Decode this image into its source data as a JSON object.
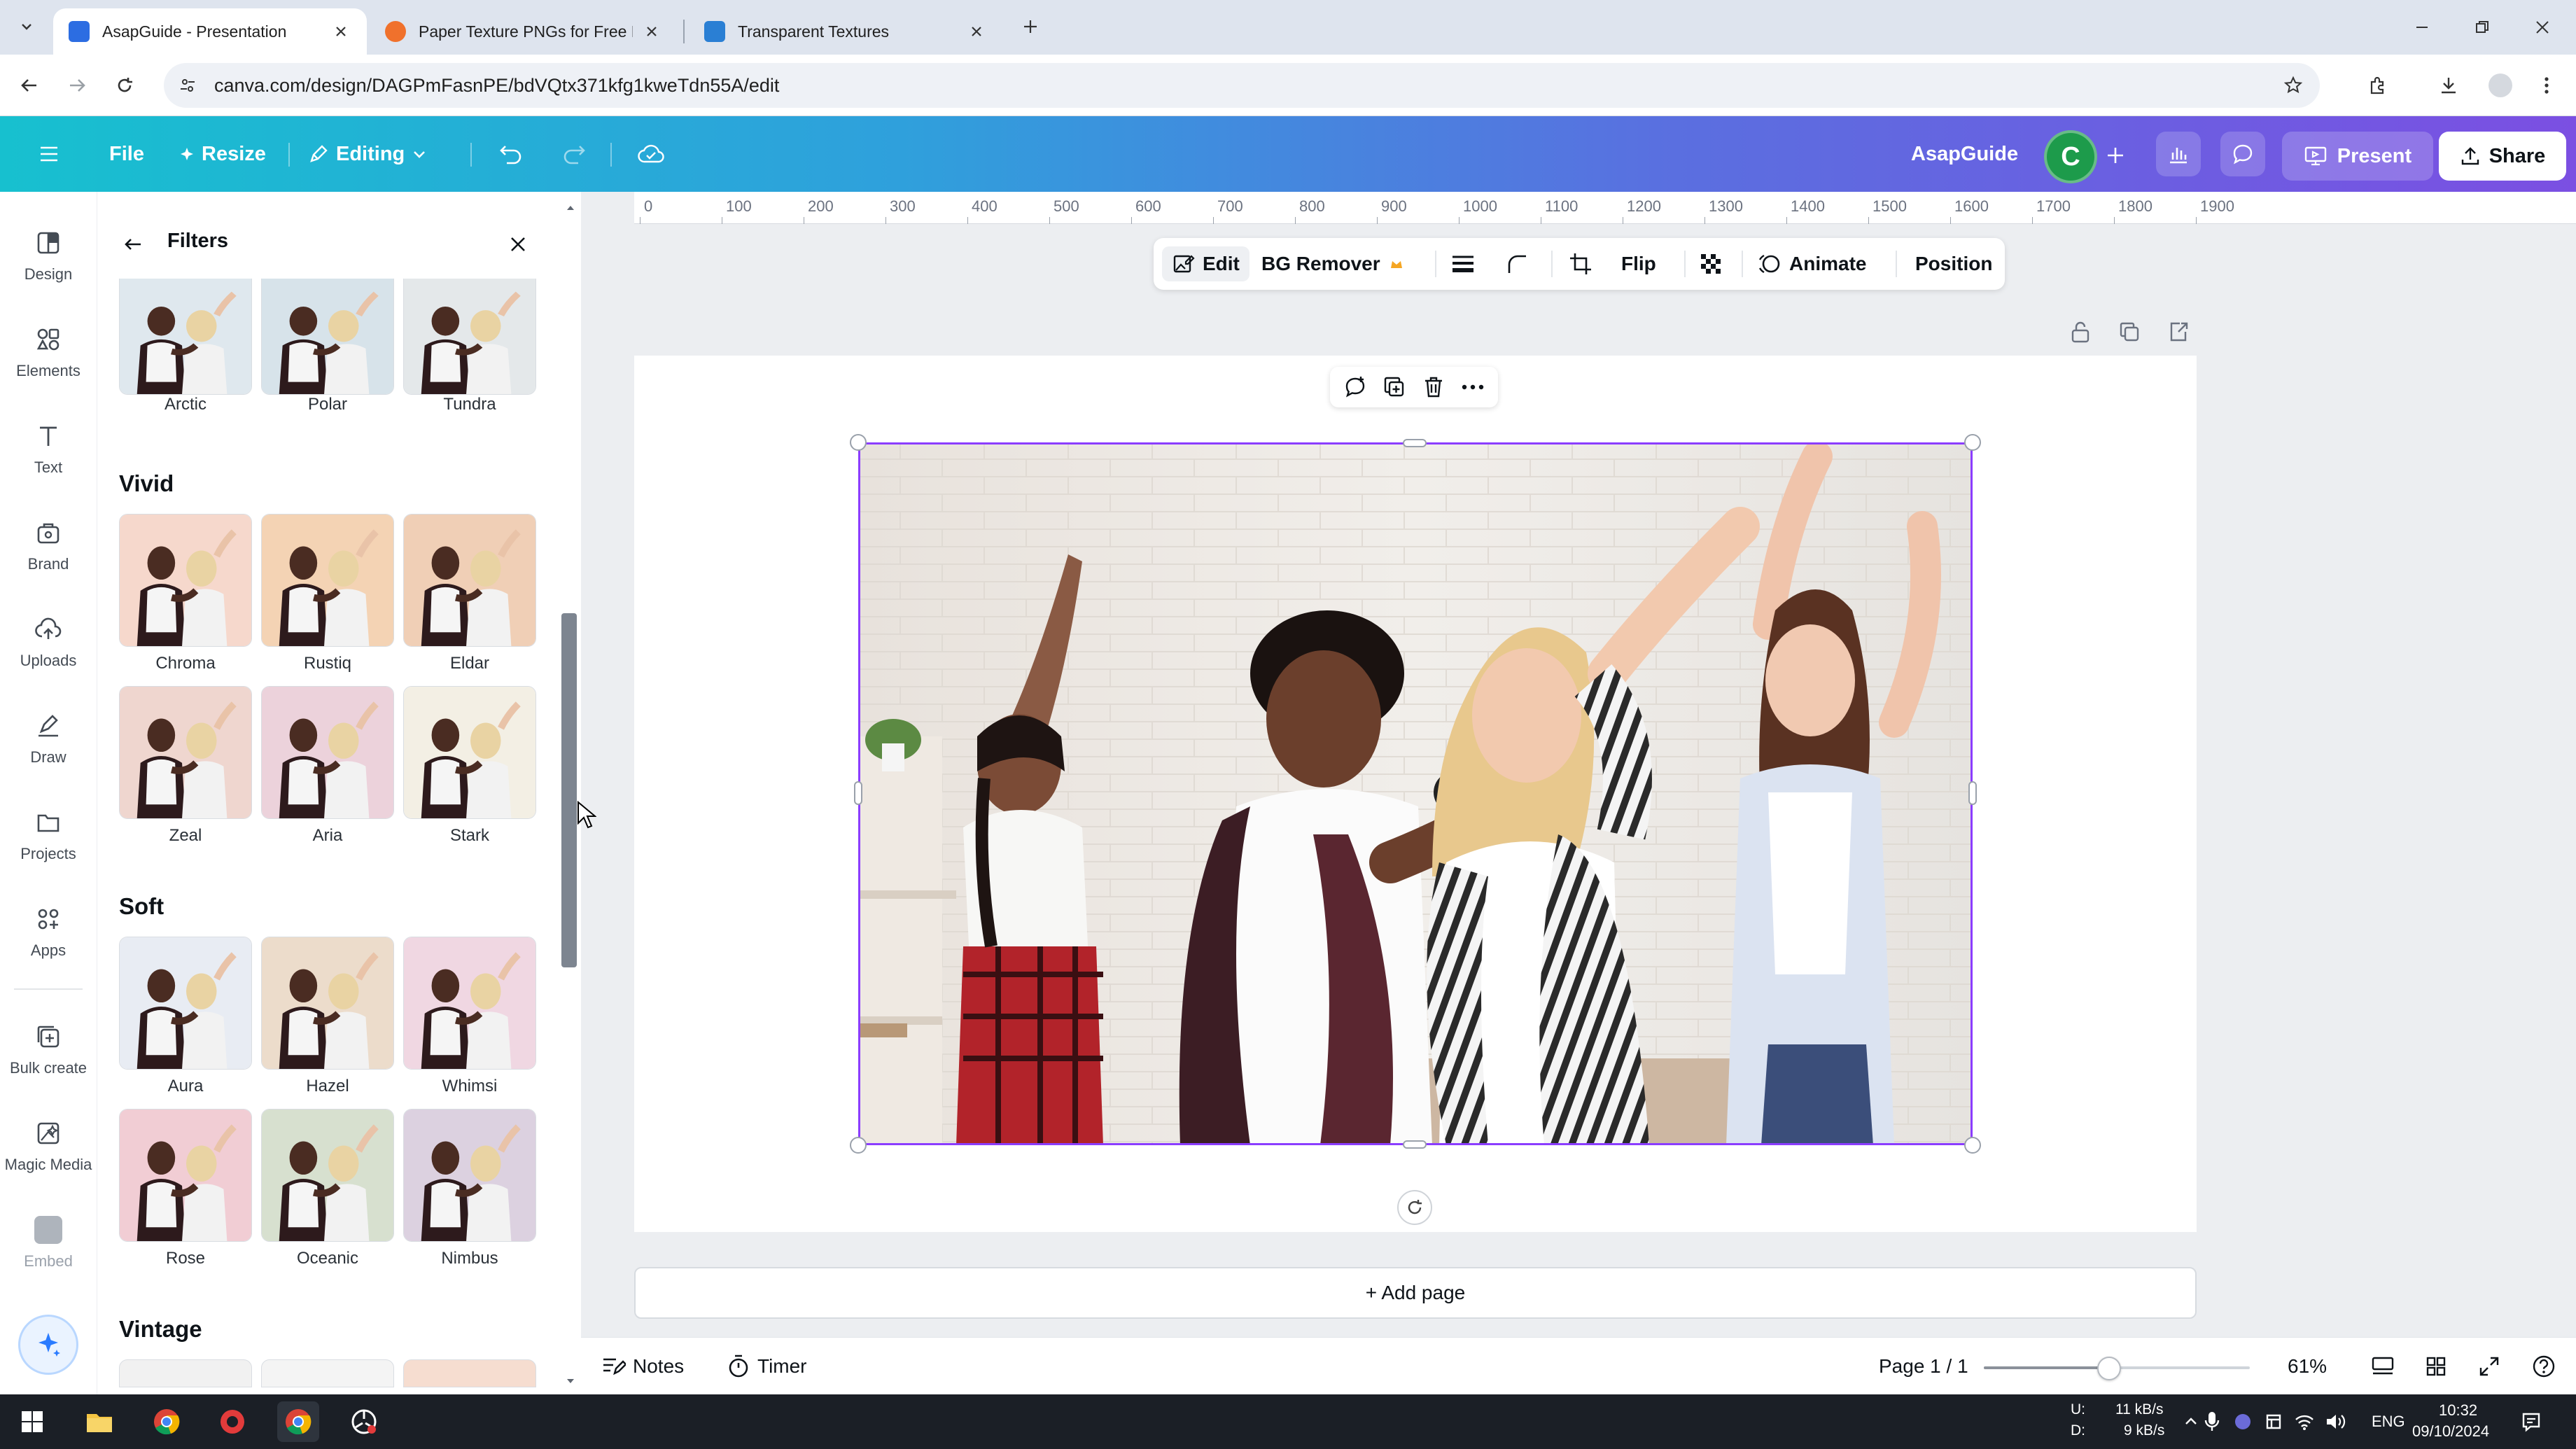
{
  "browser": {
    "tabs": [
      {
        "title": "AsapGuide - Presentation",
        "active": true,
        "favicon_color": "#2c6de2"
      },
      {
        "title": "Paper Texture PNGs for Free Do",
        "active": false,
        "favicon_color": "#f0712c"
      },
      {
        "title": "Transparent Textures",
        "active": false,
        "favicon_color": "#2a7fd4"
      }
    ],
    "url": "canva.com/design/DAGPmFasnPE/bdVQtx371kfg1kweTdn55A/edit"
  },
  "canva": {
    "menu": {
      "file": "File",
      "resize": "Resize",
      "editing": "Editing"
    },
    "brand_name": "AsapGuide",
    "avatar_letter": "C",
    "present": "Present",
    "share": "Share"
  },
  "rail": [
    {
      "label": "Design",
      "icon": "design-icon"
    },
    {
      "label": "Elements",
      "icon": "elements-icon"
    },
    {
      "label": "Text",
      "icon": "text-icon"
    },
    {
      "label": "Brand",
      "icon": "brand-icon"
    },
    {
      "label": "Uploads",
      "icon": "uploads-icon"
    },
    {
      "label": "Draw",
      "icon": "draw-icon"
    },
    {
      "label": "Projects",
      "icon": "projects-icon"
    },
    {
      "label": "Apps",
      "icon": "apps-icon"
    },
    {
      "label": "Bulk create",
      "icon": "bulk-create-icon"
    },
    {
      "label": "Magic Media",
      "icon": "magic-media-icon"
    },
    {
      "label": "Embed",
      "icon": "embed-icon"
    }
  ],
  "panel": {
    "title": "Filters",
    "top_row": [
      "Arctic",
      "Polar",
      "Tundra"
    ],
    "sections": [
      {
        "title": "Vivid",
        "items": [
          "Chroma",
          "Rustiq",
          "Eldar",
          "Zeal",
          "Aria",
          "Stark"
        ]
      },
      {
        "title": "Soft",
        "items": [
          "Aura",
          "Hazel",
          "Whimsi",
          "Rose",
          "Oceanic",
          "Nimbus"
        ]
      },
      {
        "title": "Vintage",
        "items": []
      }
    ]
  },
  "ruler": [
    "0",
    "100",
    "200",
    "300",
    "400",
    "500",
    "600",
    "700",
    "800",
    "900",
    "1000",
    "1100",
    "1200",
    "1300",
    "1400",
    "1500",
    "1600",
    "1700",
    "1800",
    "1900"
  ],
  "context_toolbar": {
    "edit": "Edit",
    "bg_remover": "BG Remover",
    "flip": "Flip",
    "animate": "Animate",
    "position": "Position"
  },
  "add_page": "+ Add page",
  "bottom": {
    "notes": "Notes",
    "timer": "Timer",
    "page": "Page 1 / 1",
    "zoom": "61%",
    "zoom_level": 0.47
  },
  "taskbar": {
    "net_up_label": "U:",
    "net_down_label": "D:",
    "net_up": "11 kB/s",
    "net_down": "9 kB/s",
    "lang": "ENG",
    "time": "10:32",
    "date": "09/10/2024"
  }
}
